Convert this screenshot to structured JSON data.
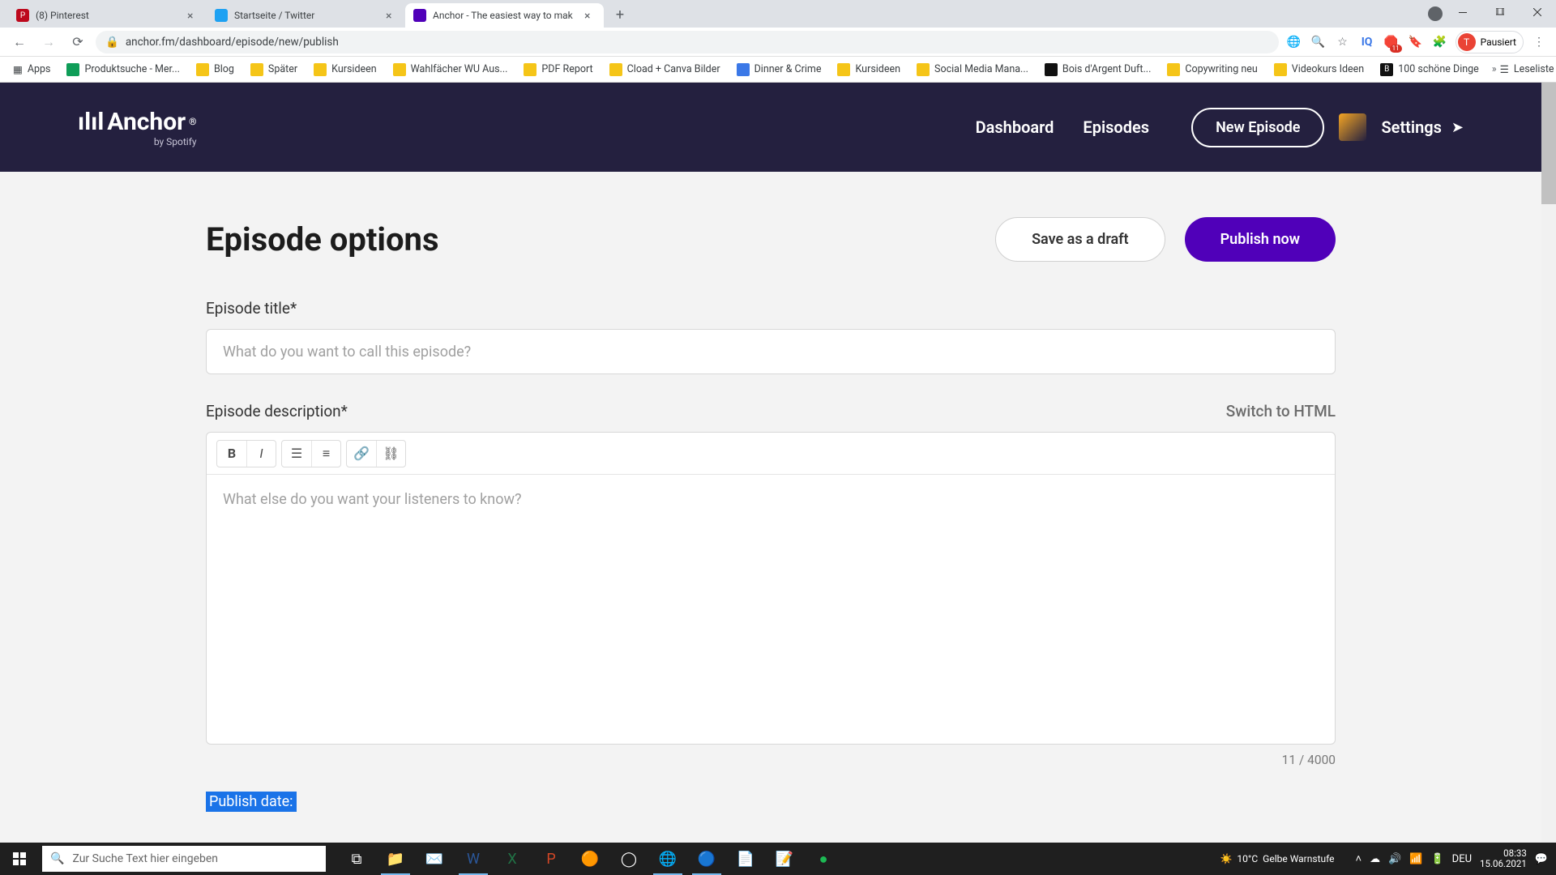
{
  "browser": {
    "tabs": [
      {
        "title": "(8) Pinterest",
        "favicon_bg": "#bd081c",
        "favicon_text": "P"
      },
      {
        "title": "Startseite / Twitter",
        "favicon_bg": "#1da1f2",
        "favicon_text": ""
      },
      {
        "title": "Anchor - The easiest way to mak",
        "favicon_bg": "#5000b9",
        "favicon_text": ""
      }
    ],
    "url": "anchor.fm/dashboard/episode/new/publish",
    "profile_label": "Pausiert",
    "profile_initial": "T",
    "ext_badge": "11",
    "bookmarks": [
      {
        "label": "Apps",
        "icon_bg": "#5f6368"
      },
      {
        "label": "Produktsuche - Mer...",
        "icon_bg": "#0f9d58"
      },
      {
        "label": "Blog",
        "icon_bg": "#f5c518"
      },
      {
        "label": "Später",
        "icon_bg": "#f5c518"
      },
      {
        "label": "Kursideen",
        "icon_bg": "#f5c518"
      },
      {
        "label": "Wahlfächer WU Aus...",
        "icon_bg": "#f5c518"
      },
      {
        "label": "PDF Report",
        "icon_bg": "#f5c518"
      },
      {
        "label": "Cload + Canva Bilder",
        "icon_bg": "#f5c518"
      },
      {
        "label": "Dinner & Crime",
        "icon_bg": "#3b78e7"
      },
      {
        "label": "Kursideen",
        "icon_bg": "#f5c518"
      },
      {
        "label": "Social Media Mana...",
        "icon_bg": "#f5c518"
      },
      {
        "label": "Bois d'Argent Duft...",
        "icon_bg": "#111111"
      },
      {
        "label": "Copywriting neu",
        "icon_bg": "#f5c518"
      },
      {
        "label": "Videokurs Ideen",
        "icon_bg": "#f5c518"
      },
      {
        "label": "100 schöne Dinge",
        "icon_bg": "#111111"
      }
    ],
    "reading_list_label": "Leseliste"
  },
  "header": {
    "logo_main": "Anchor",
    "logo_sub": "by Spotify",
    "nav": {
      "dashboard": "Dashboard",
      "episodes": "Episodes"
    },
    "new_episode": "New Episode",
    "settings": "Settings"
  },
  "page": {
    "title": "Episode options",
    "save_draft": "Save as a draft",
    "publish_now": "Publish now",
    "title_label": "Episode title*",
    "title_placeholder": "What do you want to call this episode?",
    "desc_label": "Episode description*",
    "switch_html": "Switch to HTML",
    "desc_placeholder": "What else do you want your listeners to know?",
    "char_count": "11 / 4000",
    "publish_date_label": "Publish date:"
  },
  "taskbar": {
    "search_placeholder": "Zur Suche Text hier eingeben",
    "weather_temp": "10°C",
    "weather_text": "Gelbe Warnstufe",
    "lang": "DEU",
    "time": "08:33",
    "date": "15.06.2021"
  }
}
